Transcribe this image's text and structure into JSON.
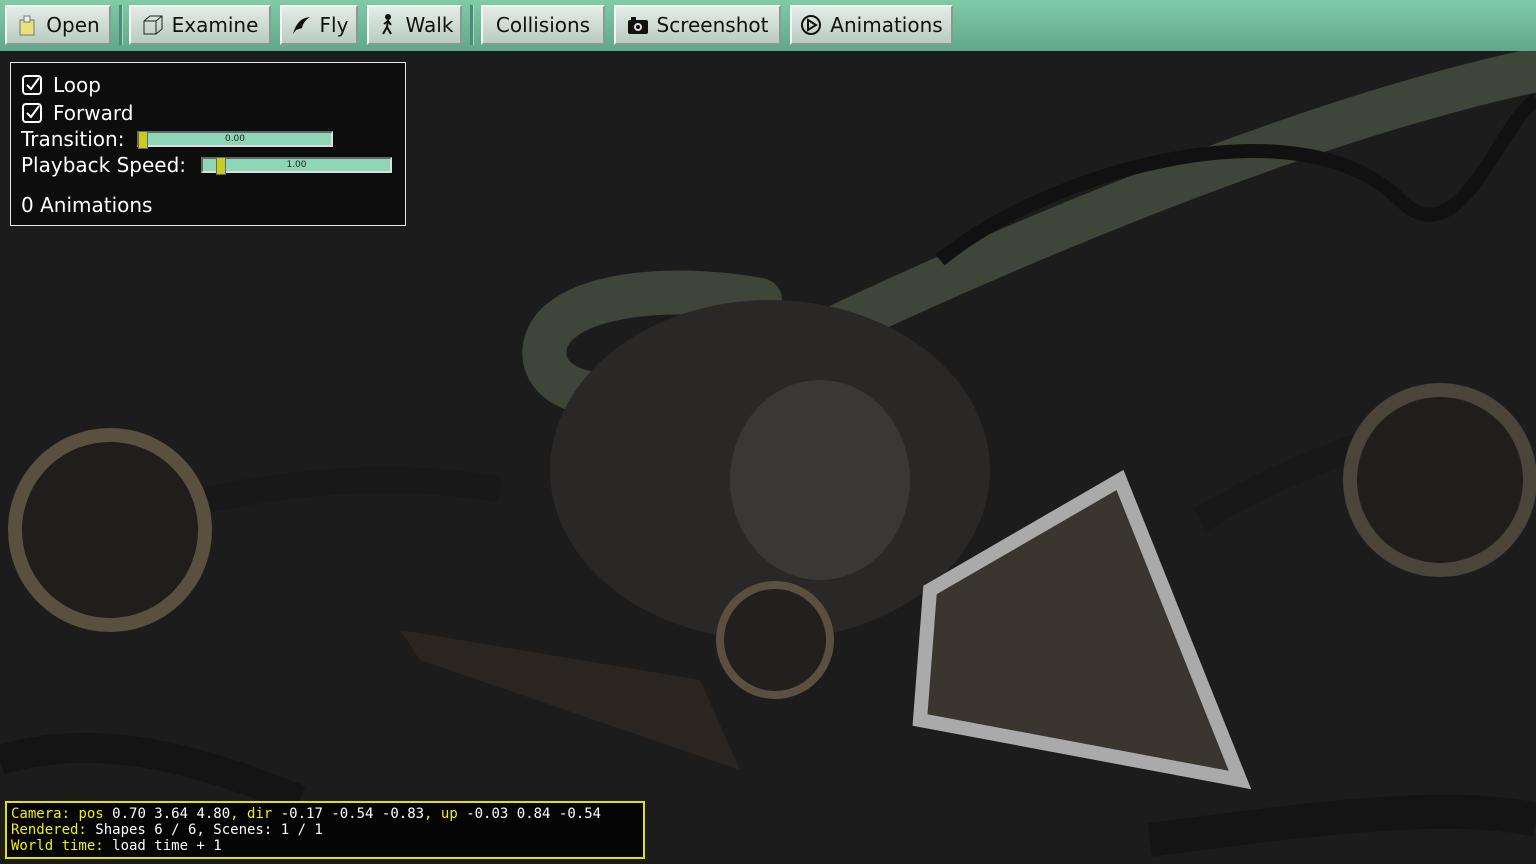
{
  "toolbar": {
    "open": "Open",
    "examine": "Examine",
    "fly": "Fly",
    "walk": "Walk",
    "collisions": "Collisions",
    "screenshot": "Screenshot",
    "animations": "Animations"
  },
  "panel": {
    "loop": {
      "label": "Loop",
      "checked": true
    },
    "forward": {
      "label": "Forward",
      "checked": true
    },
    "transition": {
      "label": "Transition:",
      "value": "0.00"
    },
    "playback_speed": {
      "label": "Playback Speed:",
      "value": "1.00"
    },
    "count": "0 Animations"
  },
  "status": {
    "camera_label": "Camera:",
    "pos_label": " pos",
    "pos": " 0.70 3.64 4.80",
    "dir_label": ", dir",
    "dir": " -0.17 -0.54 -0.83",
    "up_label": ", up",
    "up": " -0.03 0.84 -0.54",
    "rendered_label": "Rendered:",
    "rendered": " Shapes 6 / 6, Scenes: 1 / 1",
    "world_label": "World time:",
    "world": " load time + 1"
  },
  "colors": {
    "toolbar": "#6fba99",
    "slider": "#8fd6b6",
    "thumb": "#c7cc1e",
    "status_accent": "#f4f000"
  }
}
